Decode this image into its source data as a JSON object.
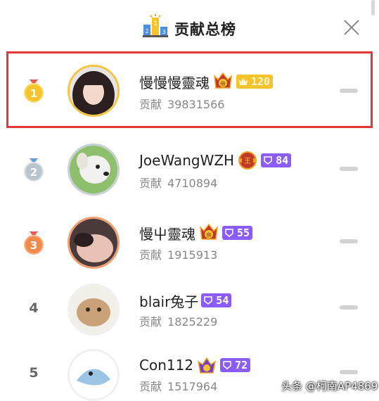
{
  "header": {
    "title": "贡献总榜",
    "podium_icon": "podium-icon",
    "close_icon": "close-icon"
  },
  "contrib_label": "贡献",
  "rows": [
    {
      "rank": "1",
      "medal": "gold",
      "name": "慢慢慢靈魂",
      "emblem": "emperor-emblem",
      "badge_value": "120",
      "badge_style": "gold",
      "contribution": "39831566"
    },
    {
      "rank": "2",
      "medal": "silver",
      "name": "JoeWangWZH",
      "emblem": "king-emblem",
      "badge_value": "84",
      "badge_style": "purple",
      "contribution": "4710894"
    },
    {
      "rank": "3",
      "medal": "bronze",
      "name": "慢屮靈魂",
      "emblem": "emperor-emblem",
      "badge_value": "55",
      "badge_style": "purple",
      "contribution": "1915913"
    },
    {
      "rank": "4",
      "medal": "none",
      "name": "blair兔子",
      "emblem": "none",
      "badge_value": "54",
      "badge_style": "purple",
      "contribution": "1825229"
    },
    {
      "rank": "5",
      "medal": "none",
      "name": "Con112",
      "emblem": "crown-emblem",
      "badge_value": "72",
      "badge_style": "purple",
      "contribution": "1517964"
    }
  ],
  "watermark": "头条 @柯南AP4869",
  "colors": {
    "highlight": "#e8343c",
    "gold_badge": "#f5c42d",
    "purple_badge": "#8b5cf6"
  }
}
